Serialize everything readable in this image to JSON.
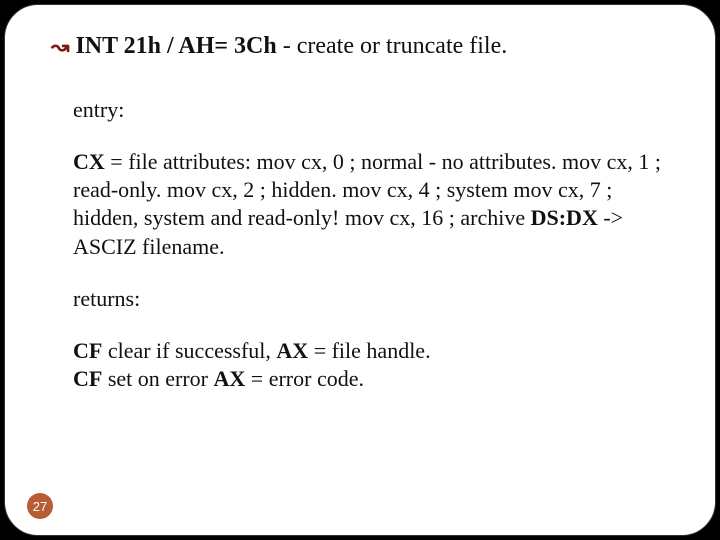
{
  "title": {
    "bold": "INT 21h / AH= 3Ch",
    "rest": " - create or truncate file."
  },
  "entry_label": "entry:",
  "cx_line_bold": "CX",
  "cx_line_rest": " = file attributes: mov cx, 0 ; normal - no attributes. mov cx, 1 ; read-only. mov cx, 2 ; hidden. mov cx, 4 ; system mov cx, 7 ; hidden, system and read-only! mov cx, 16 ; archive ",
  "dsdx_bold": "DS:DX",
  "dsdx_rest": " -> ASCIZ filename.",
  "returns_label": "returns:",
  "ret1_b1": "CF",
  "ret1_r1": " clear if successful, ",
  "ret1_b2": "AX",
  "ret1_r2": " = file handle.",
  "ret2_b1": "CF",
  "ret2_r1": " set on error ",
  "ret2_b2": "AX",
  "ret2_r2": " = error code.",
  "page_number": "27"
}
